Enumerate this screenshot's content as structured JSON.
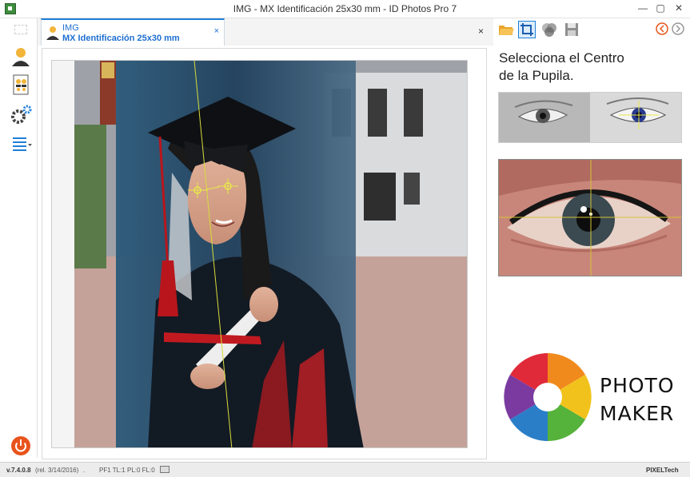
{
  "window": {
    "title": "IMG - MX Identificación 25x30 mm - ID Photos Pro 7",
    "controls": [
      "—",
      "▢",
      "✕"
    ]
  },
  "sidebar": {
    "items": [
      {
        "icon": "user-icon"
      },
      {
        "icon": "layout-sheet-icon"
      },
      {
        "icon": "settings-gears-icon"
      },
      {
        "icon": "list-menu-icon"
      },
      {
        "icon": "power-icon"
      }
    ]
  },
  "tab": {
    "name": "IMG",
    "template": "MX Identificación 25x30 mm",
    "close_label": "×"
  },
  "panel_close": "×",
  "toolbar": {
    "tools": [
      "folder-open-icon",
      "crop-icon",
      "color-adjust-icon",
      "save-icon",
      "back-icon",
      "forward-icon"
    ]
  },
  "instruction": {
    "line1": "Selecciona el Centro",
    "line2": "de la Pupila."
  },
  "logo": {
    "line1": "PHOTO",
    "line2": "MAKER"
  },
  "status": {
    "version": "v.7.4.0.8",
    "release": "(rel. 3/14/2016)",
    "sep": ".",
    "codes": "PF1 TL:1 PL:0 FL:0",
    "brand": "PIXELTech"
  },
  "colors": {
    "accent": "#1e7fd8",
    "power": "#e8541c"
  }
}
